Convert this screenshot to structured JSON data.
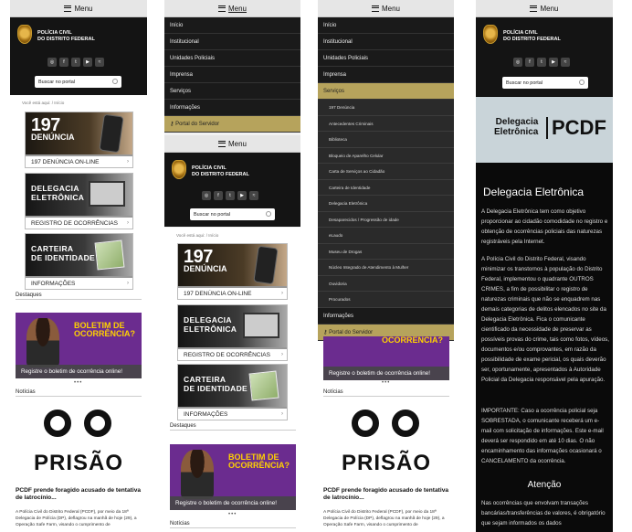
{
  "menu_label": "Menu",
  "org_name_line1": "POLÍCIA CIVIL",
  "org_name_line2": "DO DISTRITO FEDERAL",
  "social_icons": [
    "instagram-icon",
    "facebook-icon",
    "twitter-icon",
    "youtube-icon",
    "rss-icon"
  ],
  "search_placeholder": "Buscar no portal",
  "breadcrumb_prefix": "Você está aqui:",
  "breadcrumb_home": "Início",
  "banners": {
    "b197_big": "197",
    "b197_sub": "DENÚNCIA",
    "b197_foot": "197 DENÚNCIA ON-LINE",
    "de_line1": "DELEGACIA",
    "de_line2": "ELETRÔNICA",
    "de_foot": "REGISTRO DE OCORRÊNCIAS",
    "ci_line1": "CARTEIRA",
    "ci_line2": "DE IDENTIDADE",
    "ci_foot": "INFORMAÇÕES"
  },
  "destaques": "Destaques",
  "bo_title1": "BOLETIM DE",
  "bo_title2": "OCORRÊNCIA?",
  "bo_caption": "Registre o boletim de ocorrência online!",
  "noticias": "Notícias",
  "prisao": "PRISÃO",
  "news_title": "PCDF prende foragido acusado de tentativa de latrocínio...",
  "news_text": "A Polícia Civil do Distrito Federal (PCDF), por meio da 18ª Delegacia de Polícia (DP), deflagrou na manhã de hoje (29), a Operação Safe Farm, visando o cumprimento de",
  "nav_main": [
    "Início",
    "Institucional",
    "Unidades Policiais",
    "Imprensa",
    "Serviços",
    "Informações"
  ],
  "nav_portal": "Portal do Servidor",
  "services": [
    "197 Denúncia",
    "Antecedentes Criminais",
    "Biblioteca",
    "Bloqueio de Aparelho Celular",
    "Carta de Serviços ao Cidadão",
    "Carteira de Identidade",
    "Delegacia Eletrônica",
    "Desaparecidos / Progressão de idade",
    "eLaudo",
    "Museu de Drogas",
    "Núcleo Integrado de Atendimento à Mulher",
    "Ouvidoria",
    "Procurados"
  ],
  "de_logo1": "Delegacia",
  "de_logo2": "Eletrônica",
  "de_logo3": "PCDF",
  "de_heading": "Delegacia Eletrônica",
  "de_p1": "A Delegacia Eletrônica tem como objetivo proporcionar ao cidadão comodidade no registro e obtenção de ocorrências policiais das naturezas registráveis pela Internet.",
  "de_p2": "A Polícia Civil do Distrito Federal, visando minimizar os transtornos à população do Distrito Federal, implementou o quadrante OUTROS CRIMES, a fim de possibilitar o registro de naturezas criminais que não se enquadrem nas demais categorias de delitos elencados no site da Delegacia Eletrônica. Fica o comunicante cientificado da necessidade de preservar as possíveis provas do crime, tais como fotos, vídeos, documentos e/ou comprovantes, em razão da possibilidade de exame pericial, os quais deverão ser, oportunamente, apresentados à Autoridade Policial da Delegacia responsável pela apuração.",
  "de_p3": "IMPORTANTE: Caso a ocorrência policial seja SOBRESTADA, o comunicante receberá um e-mail com solicitação de informações. Este e-mail deverá ser respondido em até 10 dias. O não encaminhamento das informações ocasionará o CANCELAMENTO da ocorrência.",
  "de_attention": "Atenção",
  "de_p4": "Nas ocorrências que envolvam transações bancárias/transferências de valores, é obrigatório que sejam informados os dados"
}
